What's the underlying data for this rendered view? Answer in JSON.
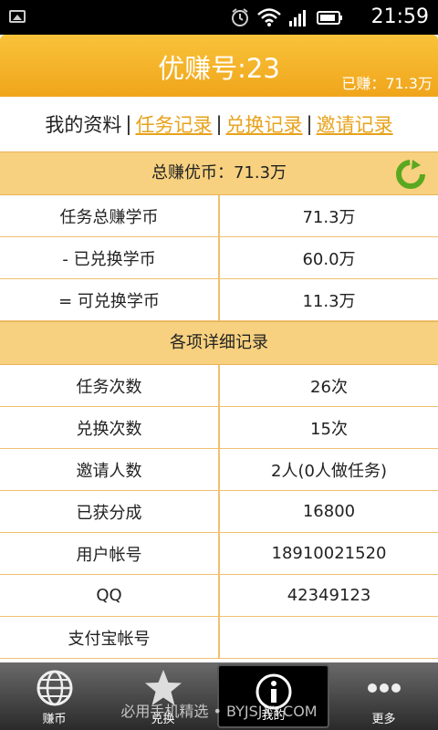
{
  "status": {
    "time": "21:59"
  },
  "header": {
    "title": "优赚号:23",
    "earned": "已赚：71.3万"
  },
  "links": {
    "my_profile": "我的资料",
    "task_log": "任务记录",
    "exchange_log": "兑换记录",
    "invite_log": "邀请记录",
    "sep": "|"
  },
  "total": {
    "label": "总赚优币：71.3万"
  },
  "summary_rows": [
    {
      "label": "任务总赚学币",
      "value": "71.3万"
    },
    {
      "label": "-  已兑换学币",
      "value": "60.0万"
    },
    {
      "label": "= 可兑换学币",
      "value": "11.3万"
    }
  ],
  "detail": {
    "label": "各项详细记录"
  },
  "detail_rows": [
    {
      "label": "任务次数",
      "value": "26次"
    },
    {
      "label": "兑换次数",
      "value": "15次"
    },
    {
      "label": "邀请人数",
      "value": "2人(0人做任务)"
    },
    {
      "label": "已获分成",
      "value": "16800"
    },
    {
      "label": "用户帐号",
      "value": "18910021520"
    },
    {
      "label": "QQ",
      "value": "42349123"
    },
    {
      "label": "支付宝帐号",
      "value": ""
    }
  ],
  "nav": [
    {
      "label": "赚币",
      "icon": "globe-icon"
    },
    {
      "label": "兑换",
      "icon": "star-icon"
    },
    {
      "label": "我的",
      "icon": "info-icon"
    },
    {
      "label": "更多",
      "icon": "more-icon"
    }
  ],
  "watermark": "必用手机精选 • BYJSJXY.COM",
  "colors": {
    "header": "#f0a51b",
    "section": "#f7d17f",
    "link": "#e8a21a",
    "refresh": "#5aa820"
  }
}
